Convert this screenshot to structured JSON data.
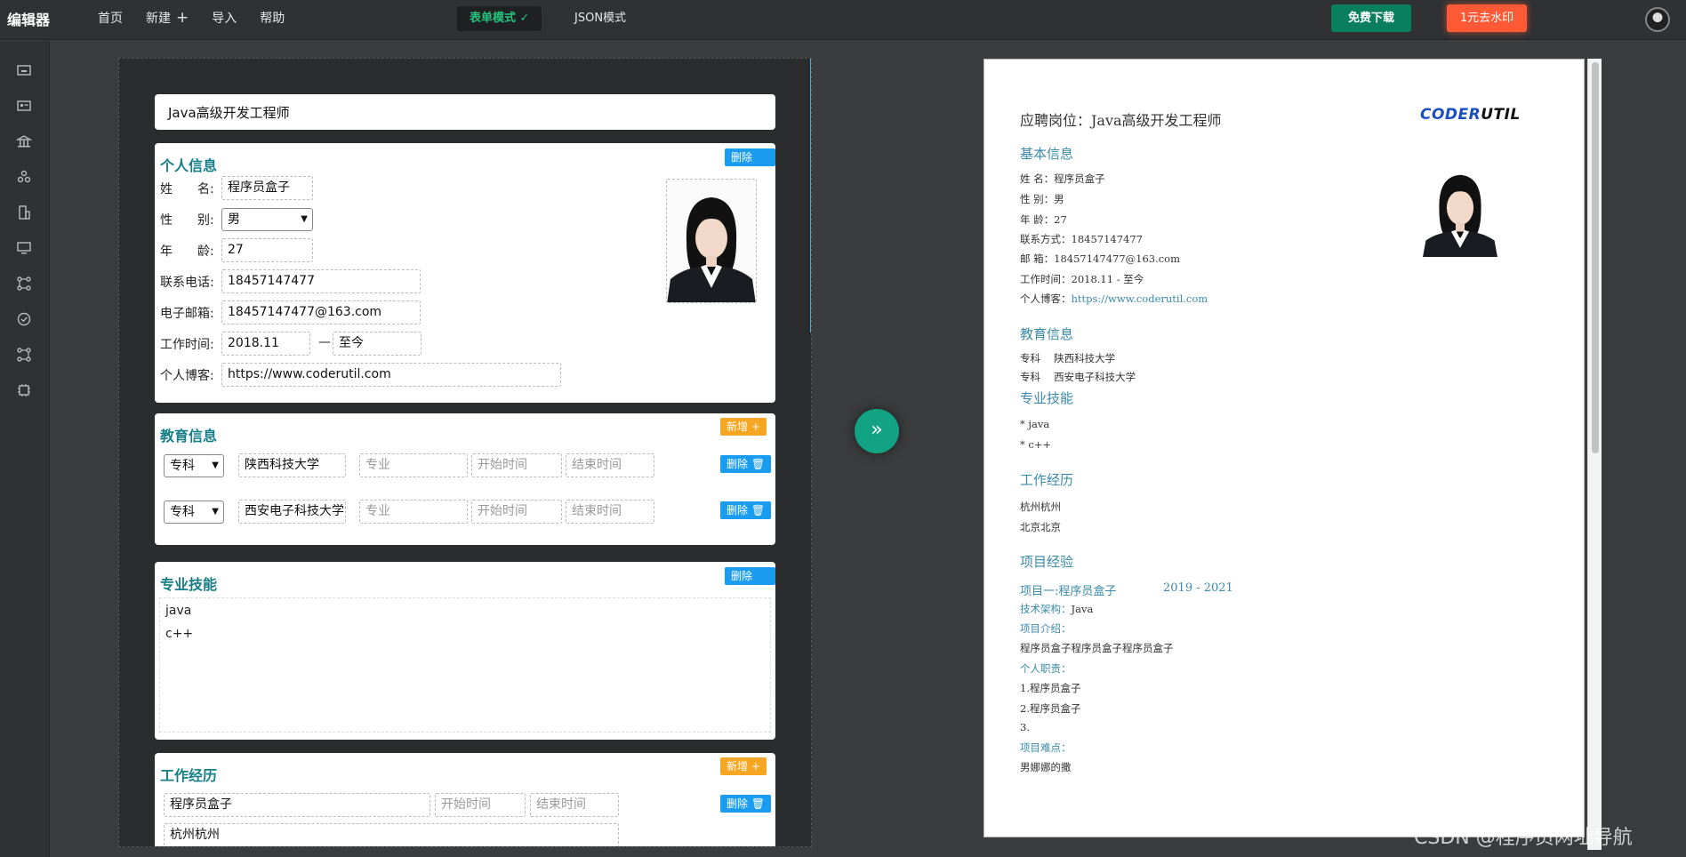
{
  "header": {
    "brand": "编辑器",
    "nav": [
      "首页",
      "新建",
      "导入",
      "帮助"
    ],
    "nav_plus": "+",
    "form_mode": "表单模式",
    "form_mode_check": "✓",
    "json_mode": "JSON模式",
    "download": "免费下载",
    "remove_watermark": "1元去水印"
  },
  "editor": {
    "job_title": "Java高级开发工程师",
    "personal": {
      "title": "个人信息",
      "delete": "删除 🗑",
      "name_label": "姓　　名:",
      "name": "程序员盒子",
      "gender_label": "性　　别:",
      "gender": "男",
      "age_label": "年　　龄:",
      "age": "27",
      "phone_label": "联系电话:",
      "phone": "18457147477",
      "email_label": "电子邮箱:",
      "email": "18457147477@163.com",
      "worktime_label": "工作时间:",
      "work_start": "2018.11",
      "work_sep": "—",
      "work_end": "至今",
      "blog_label": "个人博客:",
      "blog": "https://www.coderutil.com"
    },
    "education": {
      "title": "教育信息",
      "add": "新增 +",
      "delete": "删除 🗑",
      "major_ph": "专业",
      "start_ph": "开始时间",
      "end_ph": "结束时间",
      "rows": [
        {
          "degree": "专科",
          "school": "陕西科技大学"
        },
        {
          "degree": "专科",
          "school": "西安电子科技大学"
        }
      ]
    },
    "skills": {
      "title": "专业技能",
      "delete": "删除 🗑",
      "lines": [
        "java",
        "c++"
      ]
    },
    "work": {
      "title": "工作经历",
      "add": "新增 +",
      "delete": "删除 🗑",
      "company": "程序员盒子",
      "start_ph": "开始时间",
      "end_ph": "结束时间",
      "location": "杭州杭州"
    }
  },
  "preview": {
    "position": "应聘岗位：Java高级开发工程师",
    "logo_a": "CODER",
    "logo_b": "UTIL",
    "basic_title": "基本信息",
    "basic": [
      "姓 名：程序员盒子",
      "性 别：男",
      "年 龄：27",
      "联系方式：18457147477",
      "邮 箱：18457147477@163.com",
      "工作时间：2018.11 - 至今"
    ],
    "blog_label": "个人博客：",
    "blog": "https://www.coderutil.com",
    "edu_title": "教育信息",
    "edu": [
      "专科　 陕西科技大学",
      "专科　 西安电子科技大学"
    ],
    "skills_title": "专业技能",
    "skills": [
      "* java",
      "* c++"
    ],
    "work_title": "工作经历",
    "work": [
      "杭州杭州",
      "北京北京"
    ],
    "project_title": "项目经验",
    "project_name": "项目一:程序员盒子",
    "project_dates": "2019 - 2021",
    "tech_label": "技术架构：",
    "tech": "Java",
    "intro_label": "项目介绍：",
    "intro": "程序员盒子程序员盒子程序员盒子",
    "duty_label": "个人职责：",
    "duties": [
      "1.程序员盒子",
      "2.程序员盒子",
      "3."
    ],
    "difficulty_label": "项目难点：",
    "difficulty": "男娜娜的撒"
  },
  "watermark": "CSDN @程序员网址导航"
}
